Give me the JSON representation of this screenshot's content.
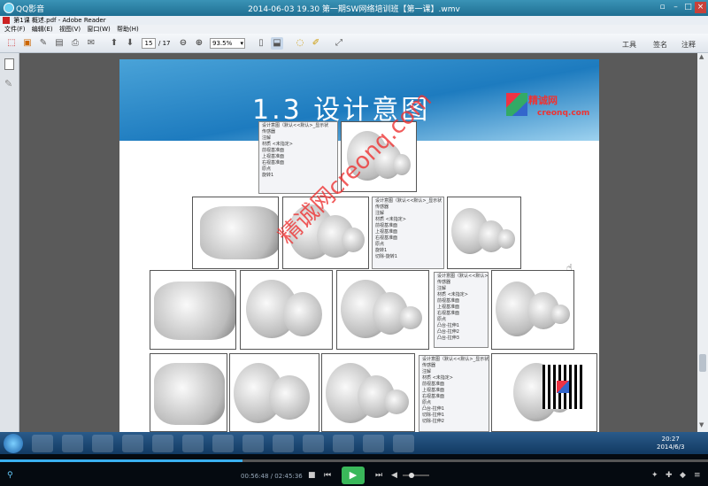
{
  "app": {
    "name": "QQ影音",
    "video_title": "2014-06-03 19.30 第一期SW网络培训班【第一课】.wmv"
  },
  "reader": {
    "doc_title": "第1课 概述.pdf - Adobe Reader",
    "menu": [
      "文件(F)",
      "编辑(E)",
      "视图(V)",
      "窗口(W)",
      "帮助(H)"
    ],
    "page_current": "15",
    "page_total": "/ 17",
    "zoom": "93.5%",
    "right_tools": {
      "tools": "工具",
      "sign": "签名",
      "comment": "注释"
    }
  },
  "slide": {
    "title": "1.3   设计意图",
    "brand_name": "精诚网",
    "brand_url": "creonq.com",
    "watermark": "精诚网creonq.com"
  },
  "trees": {
    "t1": [
      "设计意图（默认<<默认>_显示状",
      "传感器",
      "注解",
      "材质 <未指定>",
      "前视基准面",
      "上视基准面",
      "右视基准面",
      "原点",
      "旋转1"
    ],
    "t2": [
      "设计意图（默认<<默认>_显示状",
      "传感器",
      "注解",
      "材质 <未指定>",
      "前视基准面",
      "上视基准面",
      "右视基准面",
      "原点",
      "旋转1",
      "切除-旋转1"
    ],
    "t3": [
      "设计意图（默认<<默认>_",
      "传感器",
      "注解",
      "材质 <未指定>",
      "前视基准面",
      "上视基准面",
      "右视基准面",
      "原点",
      "凸台-拉伸1",
      "凸台-拉伸2",
      "凸台-拉伸3"
    ],
    "t4": [
      "设计意图（默认<<默认>_显示状",
      "传感器",
      "注解",
      "材质 <未指定>",
      "前视基准面",
      "上视基准面",
      "右视基准面",
      "原点",
      "凸台-拉伸1",
      "切除-拉伸1",
      "切除-拉伸2"
    ]
  },
  "taskbar": {
    "time": "20:27",
    "date": "2014/6/3"
  },
  "player": {
    "elapsed": "00:56:48",
    "separator": "/",
    "total": "02:45:36",
    "progress_fraction": 0.343
  }
}
